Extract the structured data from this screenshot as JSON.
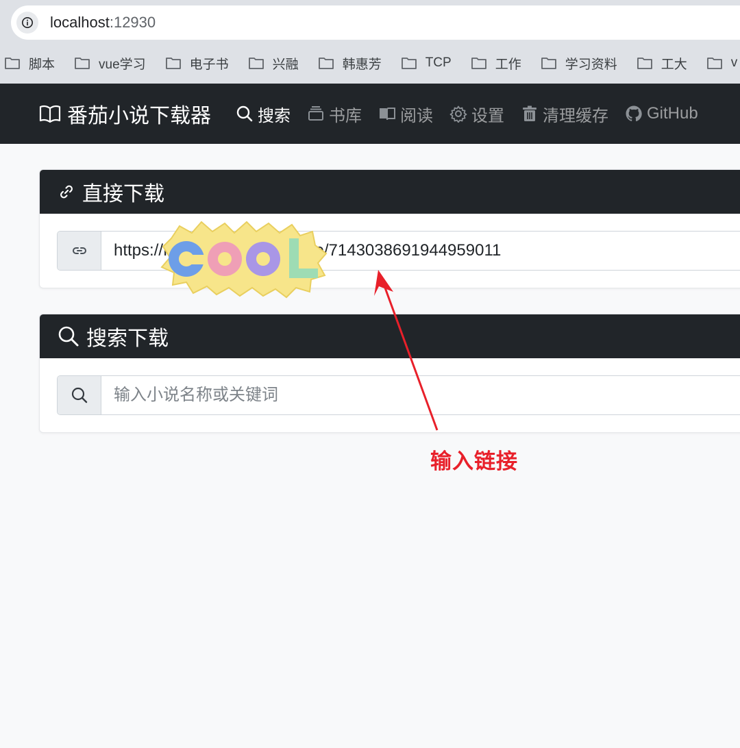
{
  "browser": {
    "address": {
      "host": "localhost",
      "port": ":12930"
    },
    "bookmarks": [
      {
        "label": "脚本"
      },
      {
        "label": "vue学习"
      },
      {
        "label": "电子书"
      },
      {
        "label": "兴融"
      },
      {
        "label": "韩惠芳"
      },
      {
        "label": "TCP"
      },
      {
        "label": "工作"
      },
      {
        "label": "学习资料"
      },
      {
        "label": "工大"
      },
      {
        "label": "v"
      }
    ]
  },
  "navbar": {
    "brand": "番茄小说下载器",
    "items": [
      {
        "label": "搜索",
        "icon": "search-icon",
        "active": true
      },
      {
        "label": "书库",
        "icon": "library-icon",
        "active": false
      },
      {
        "label": "阅读",
        "icon": "book-icon",
        "active": false
      },
      {
        "label": "设置",
        "icon": "gear-icon",
        "active": false
      },
      {
        "label": "清理缓存",
        "icon": "trash-icon",
        "active": false
      },
      {
        "label": "GitHub",
        "icon": "github-icon",
        "active": false
      }
    ]
  },
  "direct_download": {
    "title": "直接下载",
    "input_value": "https://fanqienovel.com/page/7143038691944959011"
  },
  "search_download": {
    "title": "搜索下载",
    "placeholder": "输入小说名称或关键词"
  },
  "annotation": {
    "label": "输入链接",
    "color": "#e8202a"
  },
  "sticker": {
    "text": "COOL"
  },
  "colors": {
    "navbar_bg": "#212529",
    "page_bg": "#f8f9fa",
    "chrome_bg": "#dee1e6"
  }
}
